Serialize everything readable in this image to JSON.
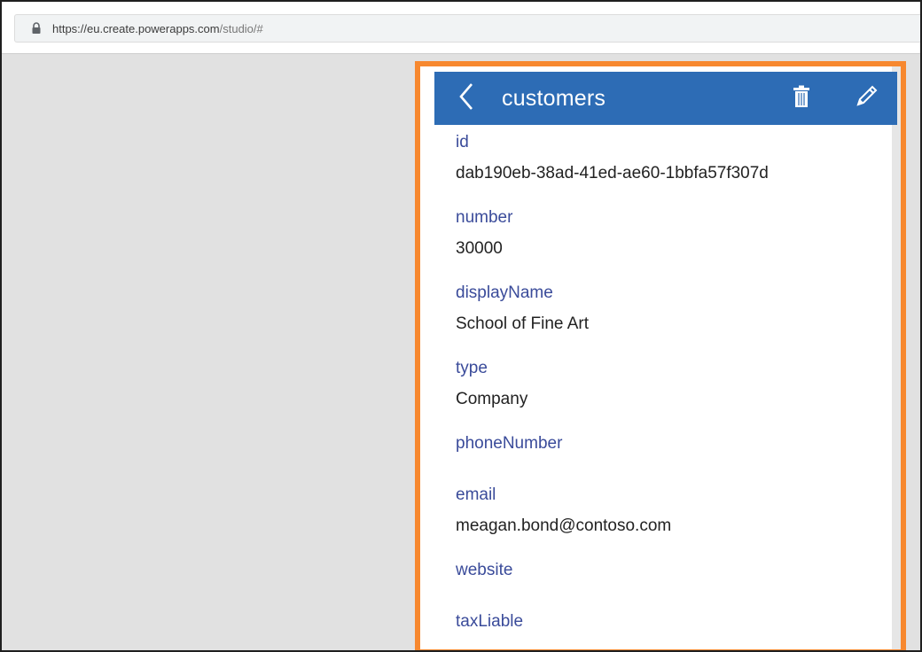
{
  "browser": {
    "url_host": "https://eu.create.powerapps.com",
    "url_path": "/studio/#"
  },
  "app": {
    "title": "customers",
    "icons": {
      "back": "chevron-left-icon",
      "delete": "trash-icon",
      "edit": "pencil-icon"
    },
    "colors": {
      "header": "#2d6cb5",
      "highlight": "#f7882f",
      "label": "#3a4b9a"
    }
  },
  "fields": [
    {
      "label": "id",
      "value": "dab190eb-38ad-41ed-ae60-1bbfa57f307d"
    },
    {
      "label": "number",
      "value": "30000"
    },
    {
      "label": "displayName",
      "value": "School of Fine Art"
    },
    {
      "label": "type",
      "value": "Company"
    },
    {
      "label": "phoneNumber",
      "value": ""
    },
    {
      "label": "email",
      "value": "meagan.bond@contoso.com"
    },
    {
      "label": "website",
      "value": ""
    },
    {
      "label": "taxLiable",
      "value": ""
    }
  ]
}
